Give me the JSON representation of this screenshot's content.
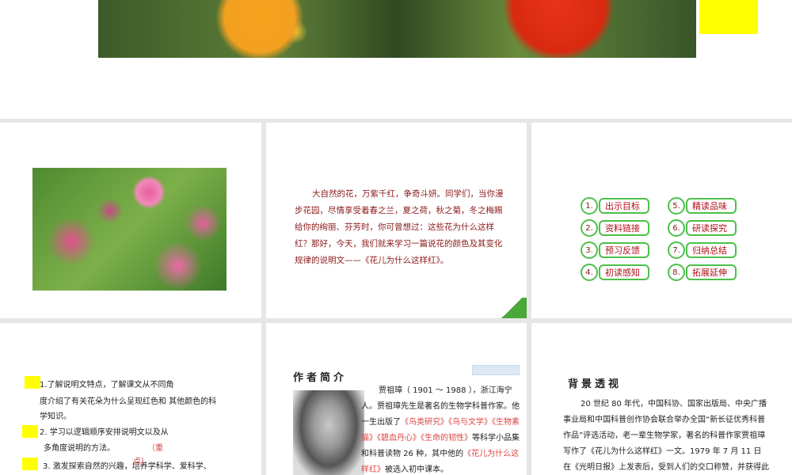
{
  "slide_intro": {
    "text": "大自然的花，万紫千红，争奇斗妍。同学们，当你漫步花园，尽情享受着春之兰，夏之荷，秋之菊，冬之梅赐给你的绚丽、芬芳时，你可曾想过：这些花为什么这样红？那好，今天，我们就来学习一篇说花的颜色及其变化规律的说明文——《花儿为什么这样红》。"
  },
  "menu": [
    {
      "num": "1.",
      "label": "出示目标"
    },
    {
      "num": "2.",
      "label": "资料链接"
    },
    {
      "num": "3.",
      "label": "预习反馈"
    },
    {
      "num": "4.",
      "label": "初读感知"
    },
    {
      "num": "5.",
      "label": "精读品味"
    },
    {
      "num": "6.",
      "label": "研读探究"
    },
    {
      "num": "7.",
      "label": "归纳总结"
    },
    {
      "num": "8.",
      "label": "拓展延伸"
    }
  ],
  "objectives": {
    "l1": "1.了解说明文特点，了解课文从不同角",
    "l2": "度介绍了有关花朵为什么呈现红色和 其他颜色的科",
    "l3": "学知识。",
    "l4": "2. 学习以逻辑顺序安排说明文以及从",
    "l5": "多角度说明的方法。",
    "l5b": "（重",
    "l6": "3.  激发探索自然的兴趣，培养学科学、爱科学、",
    "l6b": "点）"
  },
  "author": {
    "title": "作者简介",
    "p1": "贾祖璋（ 1901 ～ 1988 ），浙江海宁人。贾祖璋先生是著名的生物学科普作家。他一生出版了",
    "red": "《鸟类研究》《鸟与文学》《生物素描》《碧血丹心》《生命的韧性》",
    "p2": "等科学小品集和科普读物 26 种，其中他的",
    "red2": "《花儿为什么这样红》",
    "p3": "被选入初中课本。"
  },
  "background": {
    "title": "背景透视",
    "text": "20 世纪 80 年代，中国科协、国家出版局、中央广播事业局和中国科普创作协会联合举办全国“新长征优秀科普作品”评选活动，老一辈生物学家，著名的科普作家贾祖璋写作了《花儿为什么这样红》一文。1979 年 7 月 11 日在《光明日报》上发表后，受到人们的交口称赞，并获得此项活动一等奖。"
  }
}
